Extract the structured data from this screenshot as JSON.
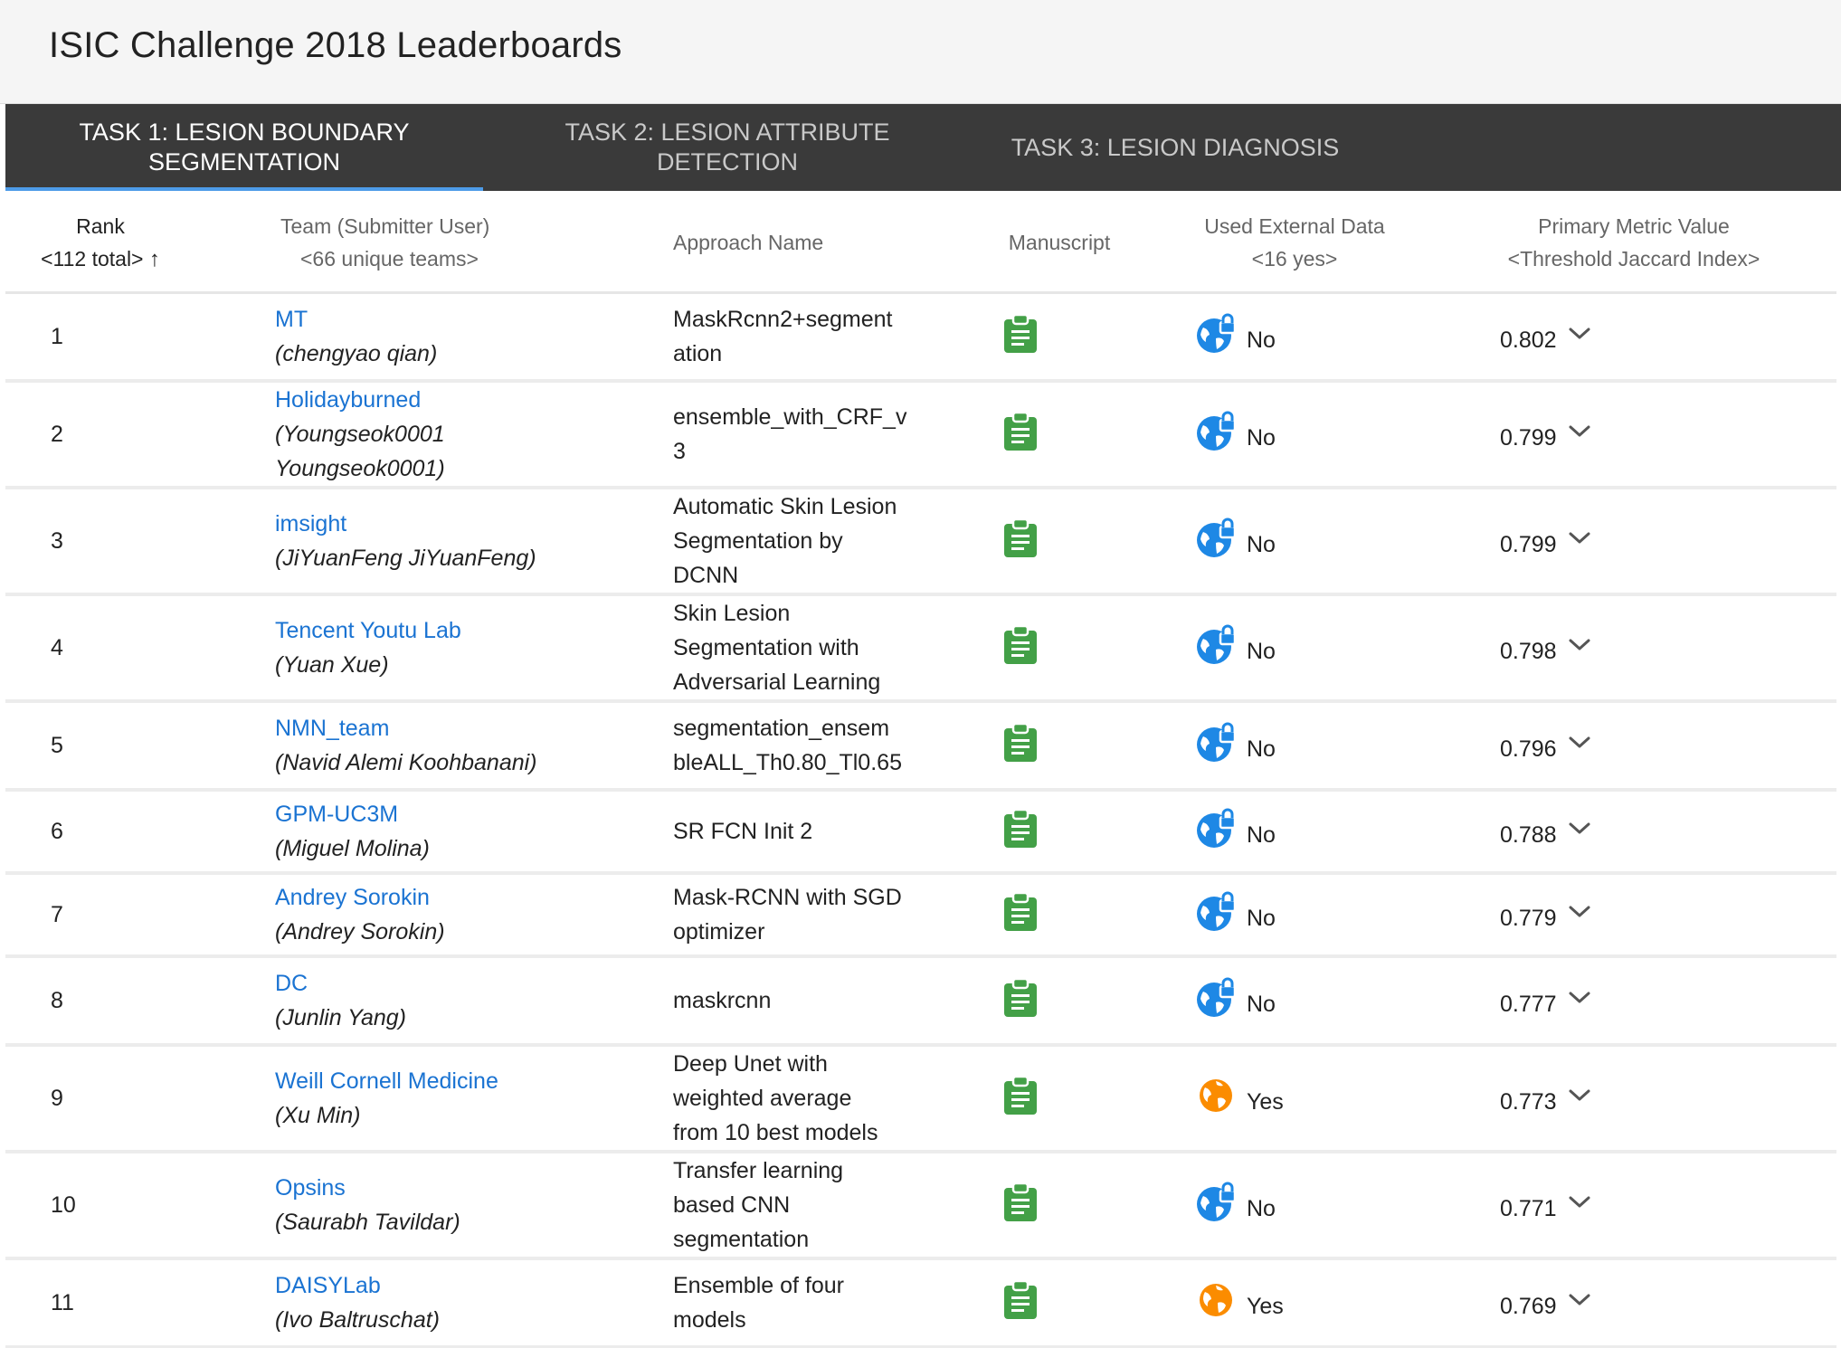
{
  "header": {
    "title": "ISIC Challenge 2018 Leaderboards"
  },
  "tabs": [
    {
      "line1": "TASK 1: LESION BOUNDARY",
      "line2": "SEGMENTATION"
    },
    {
      "line1": "TASK 2: LESION ATTRIBUTE",
      "line2": "DETECTION"
    },
    {
      "line1": "TASK 3: LESION DIAGNOSIS",
      "line2": ""
    }
  ],
  "columns": {
    "rank": {
      "label": "Rank",
      "sub": "<112 total>",
      "sort_icon": "↑"
    },
    "team": {
      "label": "Team (Submitter User)",
      "sub": "<66 unique teams>"
    },
    "approach": {
      "label": "Approach Name"
    },
    "manuscript": {
      "label": "Manuscript"
    },
    "external": {
      "label": "Used External Data",
      "sub": "<16 yes>"
    },
    "metric": {
      "label": "Primary Metric Value",
      "sub": "<Threshold Jaccard Index>"
    }
  },
  "icons": {
    "manuscript": "clipboard-icon",
    "external_no": "globe-lock-icon",
    "external_yes": "globe-icon",
    "expand": "chevron-down-icon"
  },
  "colors": {
    "link": "#1a73d2",
    "tab_bar": "#3a3a3a",
    "tab_indicator": "#4d9be8",
    "manuscript_icon": "#43a047",
    "external_no_icon": "#1e88e5",
    "external_yes_icon": "#fb8c00"
  },
  "rows": [
    {
      "rank": "1",
      "team": "MT",
      "submitter": "(chengyao qian)",
      "approach": "MaskRcnn2+segment\nation",
      "external": "No",
      "metric": "0.802"
    },
    {
      "rank": "2",
      "team": "Holidayburned",
      "submitter": "(Youngseok0001\nYoungseok0001)",
      "approach": "ensemble_with_CRF_v\n3",
      "external": "No",
      "metric": "0.799"
    },
    {
      "rank": "3",
      "team": "imsight",
      "submitter": "(JiYuanFeng JiYuanFeng)",
      "approach": "Automatic Skin Lesion\nSegmentation by\nDCNN",
      "external": "No",
      "metric": "0.799"
    },
    {
      "rank": "4",
      "team": "Tencent Youtu Lab",
      "submitter": "(Yuan Xue)",
      "approach": "Skin Lesion\nSegmentation with\nAdversarial Learning",
      "external": "No",
      "metric": "0.798"
    },
    {
      "rank": "5",
      "team": "NMN_team",
      "submitter": "(Navid Alemi Koohbanani)",
      "approach": "segmentation_ensem\nbleALL_Th0.80_Tl0.65",
      "external": "No",
      "metric": "0.796"
    },
    {
      "rank": "6",
      "team": "GPM-UC3M",
      "submitter": "(Miguel Molina)",
      "approach": "SR FCN Init 2",
      "external": "No",
      "metric": "0.788"
    },
    {
      "rank": "7",
      "team": "Andrey Sorokin",
      "submitter": "(Andrey Sorokin)",
      "approach": "Mask-RCNN with SGD\noptimizer",
      "external": "No",
      "metric": "0.779"
    },
    {
      "rank": "8",
      "team": "DC",
      "submitter": "(Junlin Yang)",
      "approach": "maskrcnn",
      "external": "No",
      "metric": "0.777"
    },
    {
      "rank": "9",
      "team": "Weill Cornell Medicine",
      "submitter": "(Xu Min)",
      "approach": "Deep Unet with\nweighted average\nfrom 10 best models",
      "external": "Yes",
      "metric": "0.773"
    },
    {
      "rank": "10",
      "team": "Opsins",
      "submitter": "(Saurabh Tavildar)",
      "approach": "Transfer learning\nbased CNN\nsegmentation",
      "external": "No",
      "metric": "0.771"
    },
    {
      "rank": "11",
      "team": "DAISYLab",
      "submitter": "(Ivo Baltruschat)",
      "approach": "Ensemble of four\nmodels",
      "external": "Yes",
      "metric": "0.769"
    }
  ]
}
